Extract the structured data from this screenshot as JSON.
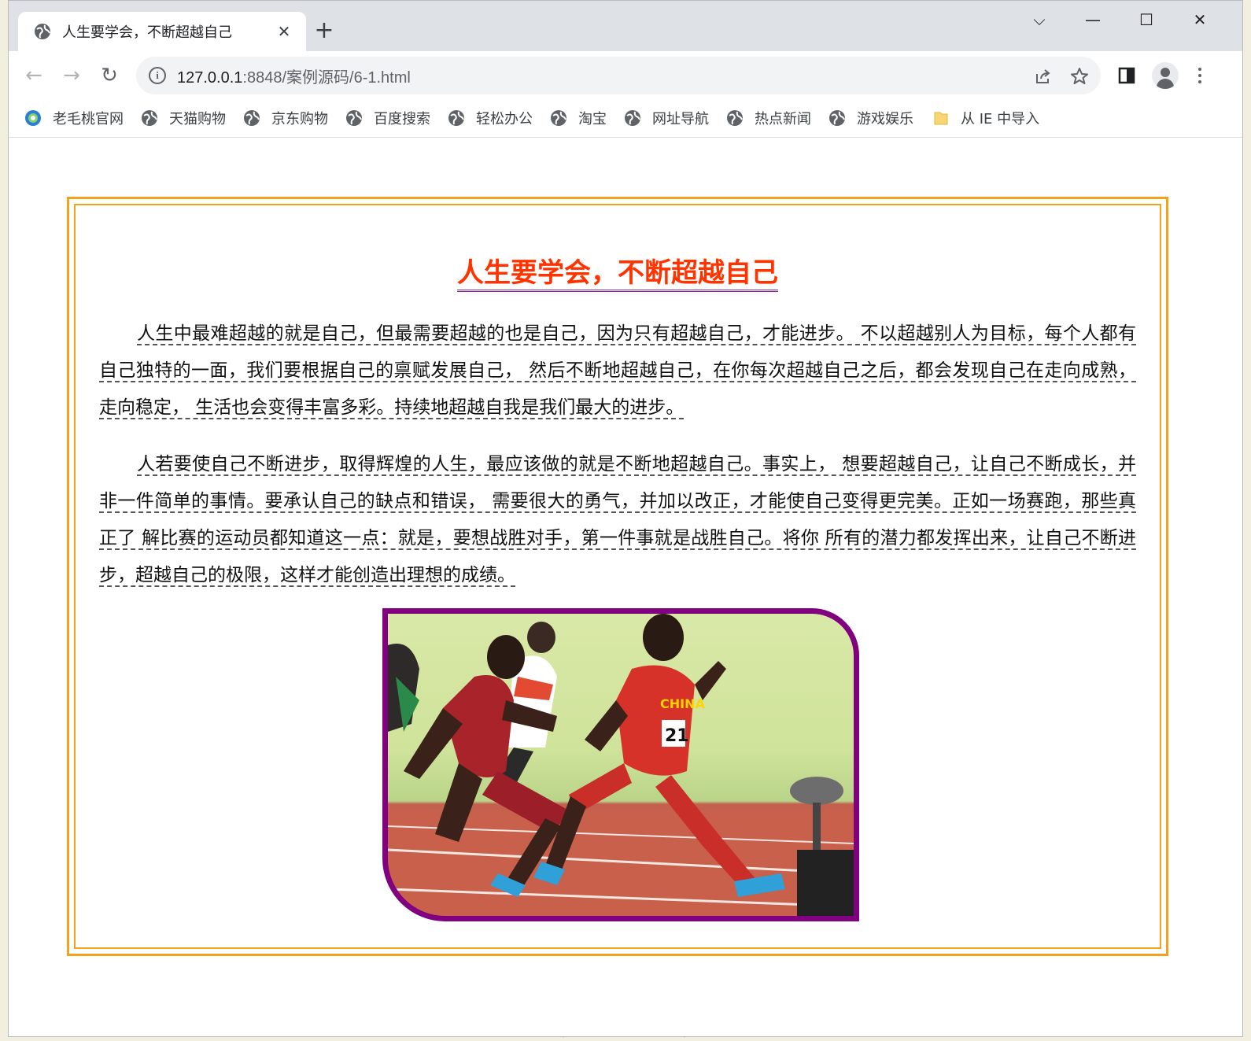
{
  "browser": {
    "tab_title": "人生要学会，不断超越自己",
    "new_tab_label": "+",
    "window_controls": {
      "dropdown": "⌵",
      "minimize": "—",
      "maximize": "☐",
      "close": "✕"
    },
    "url_host": "127.0.0.1",
    "url_rest": ":8848/案例源码/6-1.html",
    "icons": [
      "back-arrow-icon",
      "forward-arrow-icon",
      "reload-icon",
      "info-icon",
      "share-icon",
      "star-icon",
      "side-panel-icon",
      "profile-icon",
      "menu-icon"
    ]
  },
  "bookmarks": [
    {
      "label": "老毛桃官网",
      "icon": "laomaotao-logo-icon"
    },
    {
      "label": "天猫购物",
      "icon": "globe-icon"
    },
    {
      "label": "京东购物",
      "icon": "globe-icon"
    },
    {
      "label": "百度搜索",
      "icon": "globe-icon"
    },
    {
      "label": "轻松办公",
      "icon": "globe-icon"
    },
    {
      "label": "淘宝",
      "icon": "globe-icon"
    },
    {
      "label": "网址导航",
      "icon": "globe-icon"
    },
    {
      "label": "热点新闻",
      "icon": "globe-icon"
    },
    {
      "label": "游戏娱乐",
      "icon": "globe-icon"
    },
    {
      "label": "从 IE 中导入",
      "icon": "folder-icon"
    }
  ],
  "article": {
    "title": "人生要学会，不断超越自己",
    "paragraphs": [
      "人生中最难超越的就是自己，但最需要超越的也是自己，因为只有超越自己，才能进步。 不以超越别人为目标，每个人都有自己独特的一面，我们要根据自己的禀赋发展自己， 然后不断地超越自己，在你每次超越自己之后，都会发现自己在走向成熟，走向稳定， 生活也会变得丰富多彩。持续地超越自我是我们最大的进步。",
      "人若要使自己不断进步，取得辉煌的人生，最应该做的就是不断地超越自己。事实上， 想要超越自己，让自己不断成长，并非一件简单的事情。要承认自己的缺点和错误， 需要很大的勇气，并加以改正，才能使自己变得更完美。正如一场赛跑，那些真正了 解比赛的运动员都知道这一点：就是，要想战胜对手，第一件事就是战胜自己。将你 所有的潜力都发挥出来，让自己不断进步，超越自己的极限，这样才能创造出理想的成绩。"
    ],
    "photo_jersey_text": "CHINA",
    "photo_bib": "21"
  },
  "background_doc_text": "解比赛的运动员都知道这一点：就是，要想战胜对手，第一件事就是战胜自己。将你",
  "colors": {
    "title": "#ff3300",
    "frame": "#f5a11c",
    "photo_border": "#800080",
    "title_underline": "#8b1fa0"
  }
}
